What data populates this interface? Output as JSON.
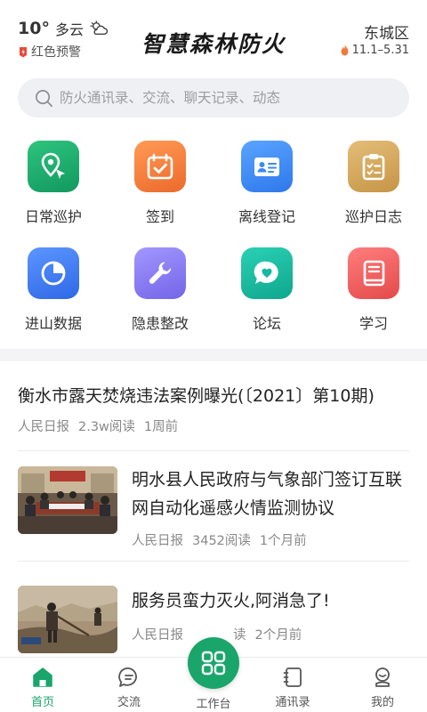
{
  "header": {
    "temperature": "10°",
    "condition": "多云",
    "weather_icon": "partly-cloudy-icon",
    "alert_text": "红色预警",
    "app_title": "智慧森林防火",
    "district": "东城区",
    "season": "11.1–5.31"
  },
  "search": {
    "placeholder": "防火通讯录、交流、聊天记录、动态"
  },
  "grid": [
    {
      "label": "日常巡护",
      "icon": "map-pin-icon",
      "color": "#1aa56b"
    },
    {
      "label": "签到",
      "icon": "calendar-check-icon",
      "color": "#f07a3a"
    },
    {
      "label": "离线登记",
      "icon": "id-card-icon",
      "color": "#3a8af5"
    },
    {
      "label": "巡护日志",
      "icon": "clipboard-icon",
      "color": "#d2a35a"
    },
    {
      "label": "进山数据",
      "icon": "pie-chart-icon",
      "color": "#3f7cf2"
    },
    {
      "label": "隐患整改",
      "icon": "wrench-icon",
      "color": "#8a7cf0"
    },
    {
      "label": "论坛",
      "icon": "chat-heart-icon",
      "color": "#16b9a3"
    },
    {
      "label": "学习",
      "icon": "book-icon",
      "color": "#ef5b5b"
    }
  ],
  "featured": {
    "title": "衡水市露天焚烧违法案例曝光(〔2021〕第10期)",
    "source": "人民日报",
    "reads": "2.3w阅读",
    "time": "1周前"
  },
  "articles": [
    {
      "title": "明水县人民政府与气象部门签订互联网自动化遥感火情监测协议",
      "source": "人民日报",
      "reads": "3452阅读",
      "time": "1个月前"
    },
    {
      "title": "服务员蛮力灭火,阿消急了!",
      "source": "人民日报",
      "reads": "读",
      "time": "2个月前"
    }
  ],
  "tabbar": {
    "home": "首页",
    "chat": "交流",
    "workbench": "工作台",
    "contacts": "通讯录",
    "mine": "我的"
  },
  "colors": {
    "brand_green": "#1aa56b",
    "alert_red": "#e84a3c",
    "flame_orange": "#f07a3a"
  }
}
